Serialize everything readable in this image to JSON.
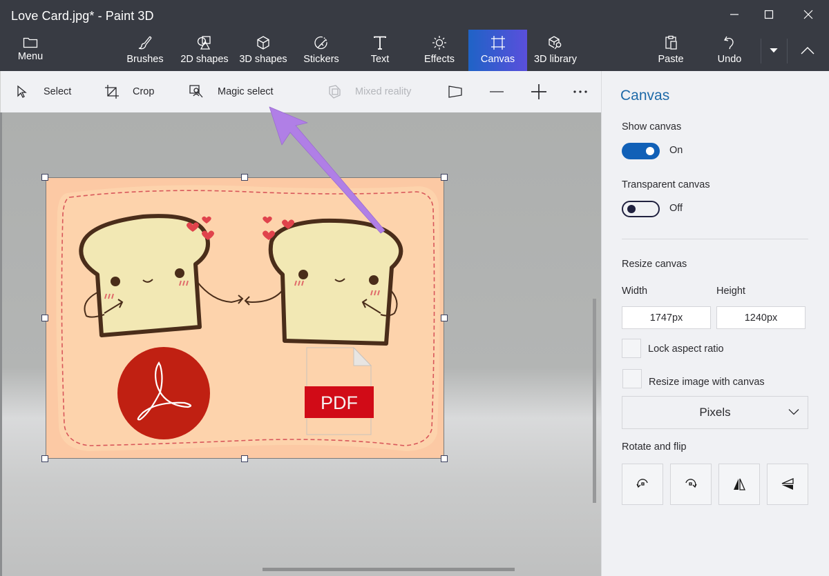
{
  "window": {
    "title": "Love Card.jpg* - Paint 3D",
    "controls": {
      "minimize": "minimize-icon",
      "maximize": "maximize-icon",
      "close": "close-icon"
    }
  },
  "ribbon": {
    "menu": {
      "label": "Menu",
      "icon": "folder-icon"
    },
    "tabs": [
      {
        "label": "Brushes",
        "icon": "brush-icon"
      },
      {
        "label": "2D shapes",
        "icon": "2d-shapes-icon"
      },
      {
        "label": "3D shapes",
        "icon": "cube-icon"
      },
      {
        "label": "Stickers",
        "icon": "sticker-icon"
      },
      {
        "label": "Text",
        "icon": "text-icon"
      },
      {
        "label": "Effects",
        "icon": "sun-icon"
      },
      {
        "label": "Canvas",
        "icon": "canvas-icon",
        "active": true
      },
      {
        "label": "3D library",
        "icon": "3d-library-icon"
      }
    ],
    "paste": {
      "label": "Paste",
      "icon": "clipboard-icon"
    },
    "undo": {
      "label": "Undo",
      "icon": "undo-icon"
    },
    "history_dropdown": "caret-down-icon",
    "collapse": "chevron-up-icon",
    "active_color": "#3f5bd6"
  },
  "toolstrip": {
    "select": "Select",
    "crop": "Crop",
    "magic_select": "Magic select",
    "mixed_reality": "Mixed reality",
    "mixed_reality_enabled": false,
    "view_icon": "perspective-view-icon",
    "zoom_out_icon": "minus-icon",
    "zoom_in_icon": "plus-icon",
    "more_icon": "more-icon"
  },
  "canvas_art": {
    "description": "Love card artwork with two toast characters holding hands, an Adobe Acrobat logo and a PDF file icon",
    "pdf_label": "PDF",
    "bg_color": "#fdd3ac",
    "border_color": "#fcc9a4",
    "accent_red": "#c8201a"
  },
  "annotation": {
    "arrow_color": "#b07fe6",
    "points_to": "Magic select"
  },
  "panel": {
    "title": "Canvas",
    "show_canvas": {
      "label": "Show canvas",
      "state": "On",
      "value": true
    },
    "transparent_canvas": {
      "label": "Transparent canvas",
      "state": "Off",
      "value": false
    },
    "resize": {
      "label": "Resize canvas",
      "width_label": "Width",
      "height_label": "Height",
      "width_value": "1747px",
      "height_value": "1240px",
      "lock_aspect": {
        "label": "Lock aspect ratio",
        "checked": false
      },
      "resize_image": {
        "label": "Resize image with canvas",
        "checked": false
      },
      "units": "Pixels"
    },
    "rotate_flip": {
      "label": "Rotate and flip",
      "buttons": [
        "rotate-left-icon",
        "rotate-right-icon",
        "flip-horizontal-icon",
        "flip-vertical-icon"
      ]
    },
    "title_color": "#1e6aa8",
    "toggle_on_color": "#1160b7"
  }
}
